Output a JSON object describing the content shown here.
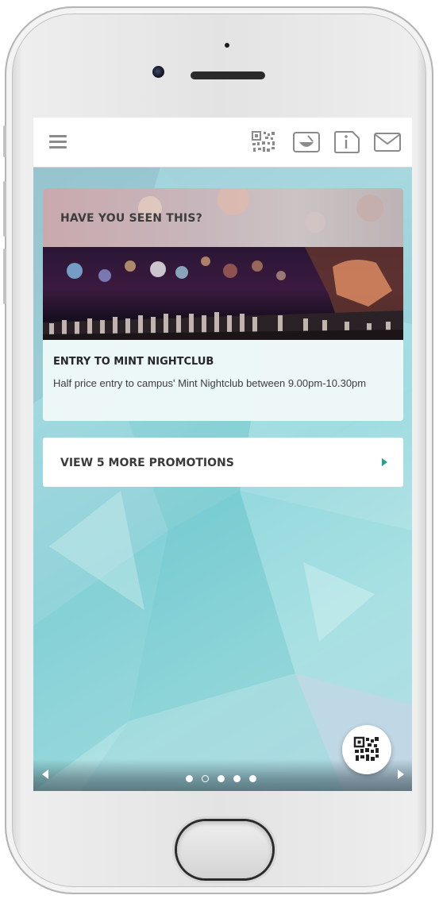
{
  "top_bar": {
    "icons": [
      "menu-icon",
      "qr-code-icon",
      "mortar-pestle-icon",
      "info-icon",
      "mail-icon"
    ]
  },
  "highlight_card": {
    "heading": "HAVE YOU SEEN THIS?",
    "promo_title": "ENTRY TO MINT NIGHTCLUB",
    "promo_description": "Half price entry to campus' Mint Nightclub between 9.00pm-10.30pm"
  },
  "more_promotions": {
    "label": "VIEW 5 MORE PROMOTIONS"
  },
  "pagination": {
    "total": 5,
    "current": 2
  },
  "colors": {
    "accent": "#20a386",
    "header_bg": "#ffffff",
    "icon_gray": "#8b8b8b",
    "screen_teal": "#7fd0d6"
  }
}
